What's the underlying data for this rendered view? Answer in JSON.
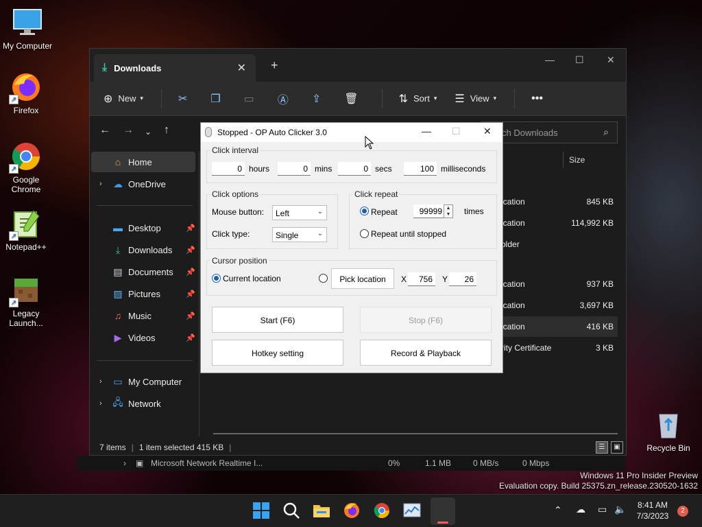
{
  "desktop": {
    "icons": [
      {
        "label": "My Computer"
      },
      {
        "label": "Firefox"
      },
      {
        "label": "Google Chrome"
      },
      {
        "label": "Notepad++"
      },
      {
        "label": "Legacy Launch..."
      },
      {
        "label": "Recycle Bin"
      }
    ],
    "watermark": {
      "line1": "Windows 11 Pro Insider Preview",
      "line2": "Evaluation copy. Build 25375.zn_release.230520-1632"
    }
  },
  "explorer": {
    "tab_title": "Downloads",
    "toolbar": {
      "new_label": "New",
      "sort_label": "Sort",
      "view_label": "View"
    },
    "search_placeholder": "ch Downloads",
    "sidebar": {
      "top": [
        {
          "label": "Home"
        },
        {
          "label": "OneDrive"
        }
      ],
      "quick": [
        {
          "label": "Desktop"
        },
        {
          "label": "Downloads"
        },
        {
          "label": "Documents"
        },
        {
          "label": "Pictures"
        },
        {
          "label": "Music"
        },
        {
          "label": "Videos"
        }
      ],
      "bottom": [
        {
          "label": "My Computer"
        },
        {
          "label": "Network"
        }
      ]
    },
    "columns": {
      "size": "Size"
    },
    "files": [
      {
        "type": "ication",
        "size": "845 KB"
      },
      {
        "type": "ication",
        "size": "114,992 KB"
      },
      {
        "type": "older",
        "size": ""
      },
      {
        "type": "ication",
        "size": "937 KB"
      },
      {
        "type": "ication",
        "size": "3,697 KB"
      },
      {
        "type": "ication",
        "size": "416 KB"
      },
      {
        "type": "rity Certificate",
        "size": "3 KB"
      }
    ],
    "status": {
      "items": "7 items",
      "selected": "1 item selected  415 KB"
    }
  },
  "taskmgr_row": {
    "name": "Microsoft Network Realtime I...",
    "cpu": "0%",
    "memory": "1.1 MB",
    "disk": "0 MB/s",
    "network": "0 Mbps"
  },
  "clicker": {
    "title": "Stopped - OP Auto Clicker 3.0",
    "interval": {
      "label": "Click interval",
      "hours": "0",
      "hours_label": "hours",
      "mins": "0",
      "mins_label": "mins",
      "secs": "0",
      "secs_label": "secs",
      "ms": "100",
      "ms_label": "milliseconds"
    },
    "options": {
      "label": "Click options",
      "mouse_button_label": "Mouse button:",
      "mouse_button_value": "Left",
      "click_type_label": "Click type:",
      "click_type_value": "Single"
    },
    "repeat": {
      "label": "Click repeat",
      "repeat_label": "Repeat",
      "repeat_value": "99999",
      "times_label": "times",
      "until_stopped_label": "Repeat until stopped"
    },
    "cursor": {
      "label": "Cursor position",
      "current_label": "Current location",
      "pick_label": "Pick location",
      "x_label": "X",
      "x_value": "756",
      "y_label": "Y",
      "y_value": "26"
    },
    "buttons": {
      "start": "Start (F6)",
      "stop": "Stop (F6)",
      "hotkey": "Hotkey setting",
      "record": "Record & Playback"
    }
  },
  "taskbar": {
    "time": "8:41 AM",
    "date": "7/3/2023",
    "notification_count": "2"
  }
}
